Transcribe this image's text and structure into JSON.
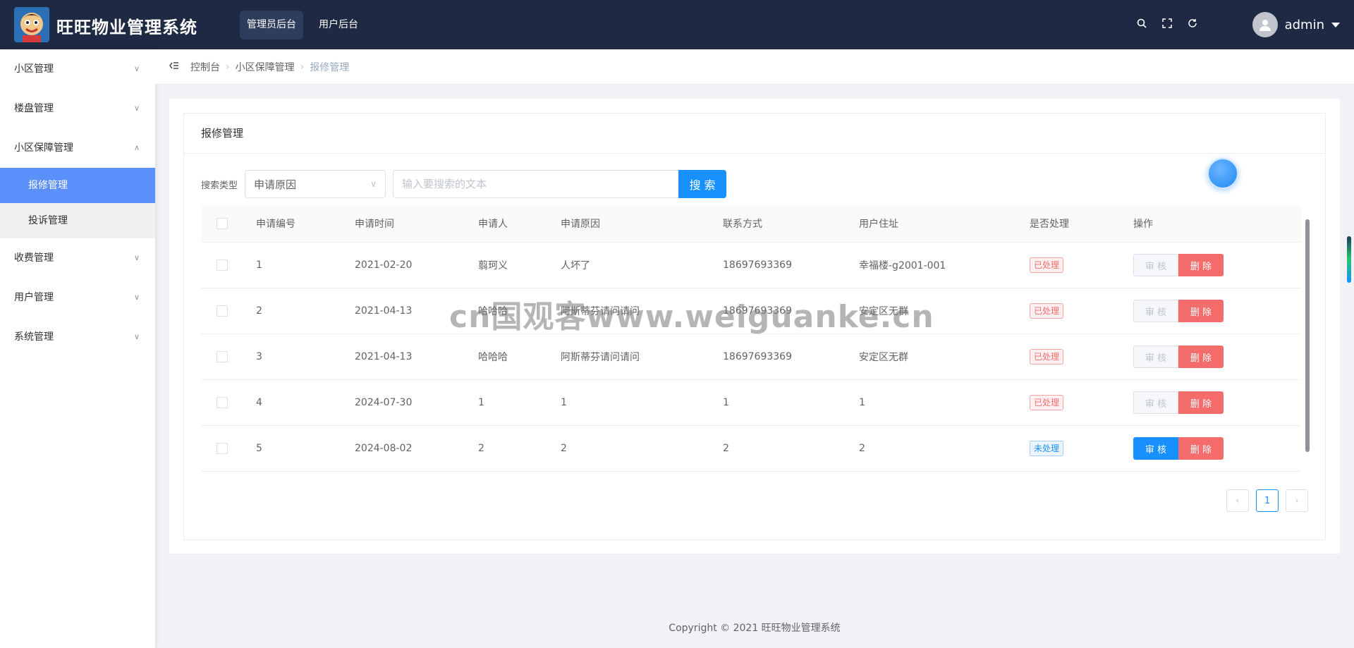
{
  "header": {
    "app_title": "旺旺物业管理系统",
    "nav": [
      {
        "label": "管理员后台",
        "active": true
      },
      {
        "label": "用户后台",
        "active": false
      }
    ],
    "icons": [
      "search-icon",
      "fullscreen-icon",
      "refresh-icon"
    ],
    "user": {
      "name": "admin"
    },
    "bg_color": "#1e2a44"
  },
  "sidebar": {
    "items": [
      {
        "label": "小区管理",
        "expanded": false
      },
      {
        "label": "楼盘管理",
        "expanded": false
      },
      {
        "label": "小区保障管理",
        "expanded": true,
        "children": [
          {
            "label": "报修管理",
            "active": true
          },
          {
            "label": "投诉管理",
            "active": false
          }
        ]
      },
      {
        "label": "收费管理",
        "expanded": false
      },
      {
        "label": "用户管理",
        "expanded": false
      },
      {
        "label": "系统管理",
        "expanded": false
      }
    ]
  },
  "breadcrumb": [
    "控制台",
    "小区保障管理",
    "报修管理"
  ],
  "card": {
    "title": "报修管理",
    "search": {
      "label": "搜索类型",
      "type_value": "申请原因",
      "placeholder": "输入要搜索的文本",
      "button_label": "搜 索"
    },
    "table": {
      "columns": [
        "申请编号",
        "申请时间",
        "申请人",
        "申请原因",
        "联系方式",
        "用户住址",
        "是否处理",
        "操作"
      ],
      "rows": [
        {
          "id": "1",
          "date": "2021-02-20",
          "applicant": "翦珂义",
          "reason": "人坏了",
          "phone": "18697693369",
          "address": "幸福楼-g2001-001",
          "status": "已处理",
          "processed": true
        },
        {
          "id": "2",
          "date": "2021-04-13",
          "applicant": "哈哈哈",
          "reason": "阿斯蒂芬请问请问",
          "phone": "18697693369",
          "address": "安定区无群",
          "status": "已处理",
          "processed": true
        },
        {
          "id": "3",
          "date": "2021-04-13",
          "applicant": "哈哈哈",
          "reason": "阿斯蒂芬请问请问",
          "phone": "18697693369",
          "address": "安定区无群",
          "status": "已处理",
          "processed": true
        },
        {
          "id": "4",
          "date": "2024-07-30",
          "applicant": "1",
          "reason": "1",
          "phone": "1",
          "address": "1",
          "status": "已处理",
          "processed": true
        },
        {
          "id": "5",
          "date": "2024-08-02",
          "applicant": "2",
          "reason": "2",
          "phone": "2",
          "address": "2",
          "status": "未处理",
          "processed": false
        }
      ],
      "audit_label": "审 核",
      "delete_label": "删 除"
    },
    "pagination": {
      "current": "1"
    }
  },
  "footer": {
    "text": "Copyright © 2021 旺旺物业管理系统"
  },
  "watermark": "cn国观客www.weiguanke.cn",
  "colors": {
    "primary": "#1890ff",
    "danger": "#f56c6c",
    "menu_active": "#5b8ff9"
  }
}
